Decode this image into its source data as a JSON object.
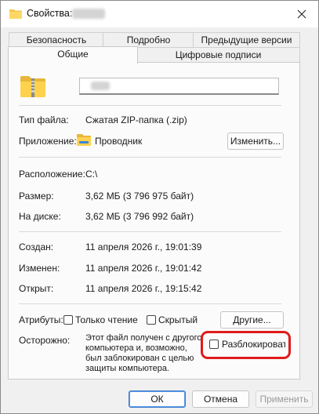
{
  "window": {
    "title": "Свойства:",
    "title_filename_redacted": "archive"
  },
  "tabs": {
    "back_row": [
      "Безопасность",
      "Подробно",
      "Предыдущие версии"
    ],
    "front_row": [
      "Общие",
      "Цифровые подписи"
    ],
    "active": "Общие"
  },
  "general": {
    "file_name_redacted": "name",
    "file_type_label": "Тип файла:",
    "file_type_value": "Сжатая ZIP-папка (.zip)",
    "opens_with_label": "Приложение:",
    "opens_with_value": "Проводник",
    "change_button": "Изменить...",
    "location_label": "Расположение:",
    "location_value": "C:\\",
    "size_label": "Размер:",
    "size_value": "3,62 МБ (3 796 975 байт)",
    "size_on_disk_label": "На диске:",
    "size_on_disk_value": "3,62 МБ (3 796 992 байт)",
    "created_label": "Создан:",
    "created_value": "11 апреля 2026 г., 19:01:39",
    "modified_label": "Изменен:",
    "modified_value": "11 апреля 2026 г., 19:01:42",
    "accessed_label": "Открыт:",
    "accessed_value": "11 апреля 2026 г., 19:15:42",
    "attributes_label": "Атрибуты:",
    "readonly_label": "Только чтение",
    "hidden_label": "Скрытый",
    "advanced_button": "Другие...",
    "security_label": "Осторожно:",
    "security_text": "Этот файл получен с другого компьютера и, возможно, был заблокирован с целью защиты компьютера.",
    "unblock_label": "Разблокироват"
  },
  "footer": {
    "ok": "ОК",
    "cancel": "Отмена",
    "apply": "Применить"
  },
  "colors": {
    "highlight": "#e01b1b",
    "folder": "#f2c94c",
    "primary_border": "#3b78d0"
  },
  "icons": [
    "folder-icon",
    "zip-folder-icon",
    "explorer-folder-icon",
    "close-icon"
  ],
  "state": {
    "readonly_checked": false,
    "hidden_checked": false,
    "unblock_checked": false
  }
}
